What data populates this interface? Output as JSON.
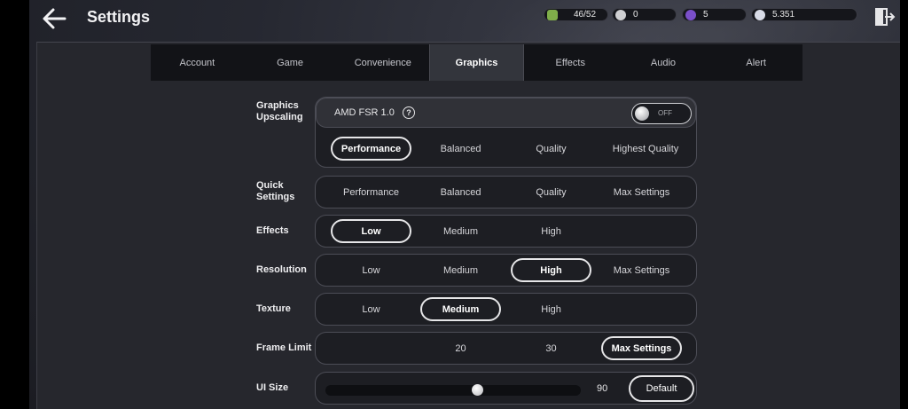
{
  "header": {
    "title": "Settings"
  },
  "resources": [
    {
      "name": "stamina-icon",
      "value": "46/52",
      "color": "#7fae4a"
    },
    {
      "name": "silver-coin-icon",
      "value": "0",
      "color": "#cfcfd2"
    },
    {
      "name": "purple-gem-icon",
      "value": "5",
      "color": "#7a4fc9"
    },
    {
      "name": "moon-coin-icon",
      "value": "5.351",
      "color": "#d8dbe6"
    }
  ],
  "tabs": [
    "Account",
    "Game",
    "Convenience",
    "Graphics",
    "Effects",
    "Audio",
    "Alert"
  ],
  "active_tab": "Graphics",
  "upscaling": {
    "label_line1": "Graphics",
    "label_line2": "Upscaling",
    "mode": "AMD FSR 1.0",
    "help": "?",
    "toggle": "OFF",
    "options": [
      "Performance",
      "Balanced",
      "Quality",
      "Highest Quality"
    ],
    "selected": "Performance"
  },
  "quick": {
    "label_line1": "Quick",
    "label_line2": "Settings",
    "options": [
      "Performance",
      "Balanced",
      "Quality",
      "Max Settings"
    ]
  },
  "effects": {
    "label": "Effects",
    "options": [
      "Low",
      "Medium",
      "High"
    ],
    "selected": "Low"
  },
  "resolution": {
    "label": "Resolution",
    "options": [
      "Low",
      "Medium",
      "High",
      "Max Settings"
    ],
    "selected": "High"
  },
  "texture": {
    "label": "Texture",
    "options": [
      "Low",
      "Medium",
      "High"
    ],
    "selected": "Medium"
  },
  "frame_limit": {
    "label": "Frame Limit",
    "options": [
      "20",
      "30",
      "Max Settings"
    ],
    "selected": "Max Settings"
  },
  "ui_size": {
    "label": "UI Size",
    "value": "90",
    "level_fraction": 0.6,
    "default_label": "Default"
  }
}
